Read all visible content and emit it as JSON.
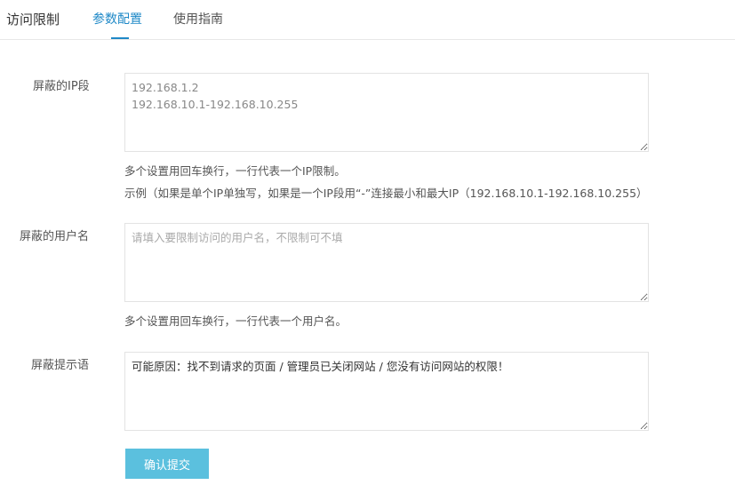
{
  "tabs": {
    "title": "访问限制",
    "items": [
      {
        "label": "参数配置",
        "active": true
      },
      {
        "label": "使用指南",
        "active": false
      }
    ]
  },
  "form": {
    "ip": {
      "label": "屏蔽的IP段",
      "value": "192.168.1.2\n192.168.10.1-192.168.10.255",
      "hint1": "多个设置用回车换行，一行代表一个IP限制。",
      "hint2": "示例（如果是单个IP单独写，如果是一个IP段用“-”连接最小和最大IP（192.168.10.1-192.168.10.255）"
    },
    "user": {
      "label": "屏蔽的用户名",
      "value": "",
      "placeholder": "请填入要限制访问的用户名，不限制可不填",
      "hint": "多个设置用回车换行，一行代表一个用户名。"
    },
    "message": {
      "label": "屏蔽提示语",
      "value": "可能原因：找不到请求的页面 / 管理员已关闭网站 / 您没有访问网站的权限！"
    },
    "submit_label": "确认提交"
  },
  "colors": {
    "accent": "#1e88c7",
    "button": "#5bc0de"
  }
}
